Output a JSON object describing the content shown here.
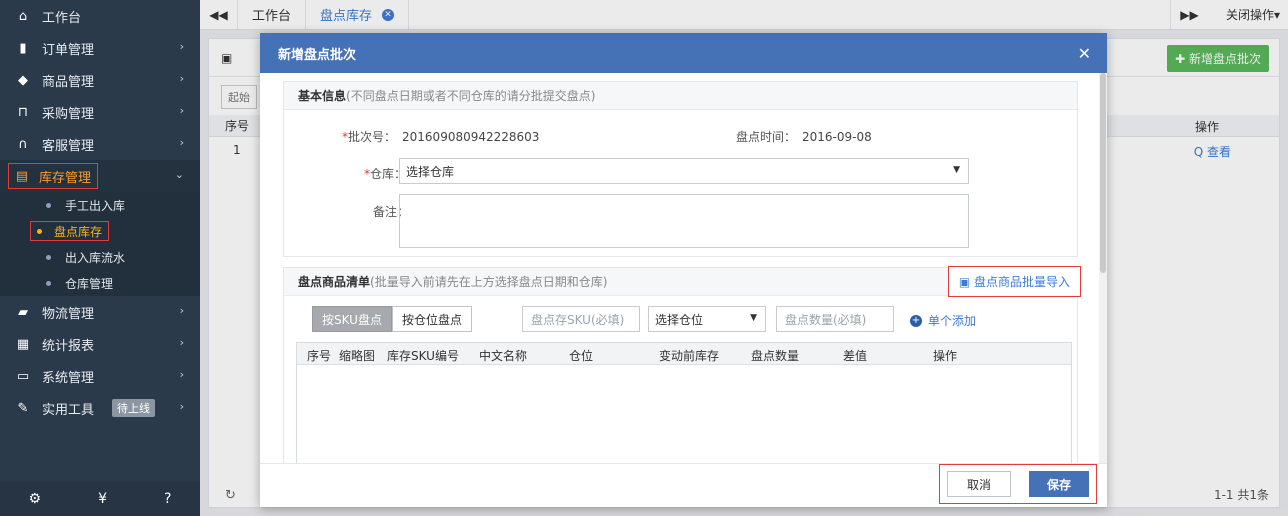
{
  "sidebar": {
    "items": [
      {
        "icon": "home-icon",
        "glyph": "⌂",
        "label": "工作台"
      },
      {
        "icon": "clipboard-icon",
        "glyph": "▮",
        "label": "订单管理"
      },
      {
        "icon": "box-icon",
        "glyph": "◆",
        "label": "商品管理"
      },
      {
        "icon": "cart-icon",
        "glyph": "⊓",
        "label": "采购管理"
      },
      {
        "icon": "headset-icon",
        "glyph": "∩",
        "label": "客服管理"
      },
      {
        "icon": "inventory-icon",
        "glyph": "▤",
        "label": "库存管理"
      },
      {
        "icon": "truck-icon",
        "glyph": "▰",
        "label": "物流管理"
      },
      {
        "icon": "report-icon",
        "glyph": "▦",
        "label": "统计报表"
      },
      {
        "icon": "monitor-icon",
        "glyph": "▭",
        "label": "系统管理"
      },
      {
        "icon": "wrench-icon",
        "glyph": "✎",
        "label": "实用工具",
        "badge": "待上线"
      }
    ],
    "sub": [
      "手工出入库",
      "盘点库存",
      "出入库流水",
      "仓库管理"
    ]
  },
  "topbar": {
    "tabs": [
      "工作台",
      "盘点库存"
    ],
    "right_label": "关闭操作▾"
  },
  "background": {
    "add_batch": "✚ 新增盘点批次",
    "filter": "起始",
    "col_index": "序号",
    "col_ops": "操作",
    "row_index": "1",
    "view_link": "Q 查看",
    "pager": "1-1  共1条"
  },
  "modal": {
    "title": "新增盘点批次",
    "basic_title": "基本信息",
    "basic_hint": "(不同盘点日期或者不同仓库的请分批提交盘点)",
    "batch_label": "批次号：",
    "batch_value": "201609080942228603",
    "date_label": "盘点时间：",
    "date_value": "2016-09-08",
    "warehouse_label": "仓库：",
    "warehouse_value": "选择仓库",
    "note_label": "备注：",
    "list_title": "盘点商品清单",
    "list_hint": "(批量导入前请先在上方选择盘点日期和仓库)",
    "import_label": "盘点商品批量导入",
    "mode_sku": "按SKU盘点",
    "mode_loc": "按仓位盘点",
    "sku_placeholder": "盘点存SKU(必填)",
    "location_select": "选择仓位",
    "qty_placeholder": "盘点数量(必填)",
    "add_single": "单个添加",
    "columns": [
      "序号",
      "缩略图",
      "库存SKU编号",
      "中文名称",
      "仓位",
      "变动前库存",
      "盘点数量",
      "差值",
      "操作"
    ],
    "cancel": "取消",
    "save": "保存"
  }
}
